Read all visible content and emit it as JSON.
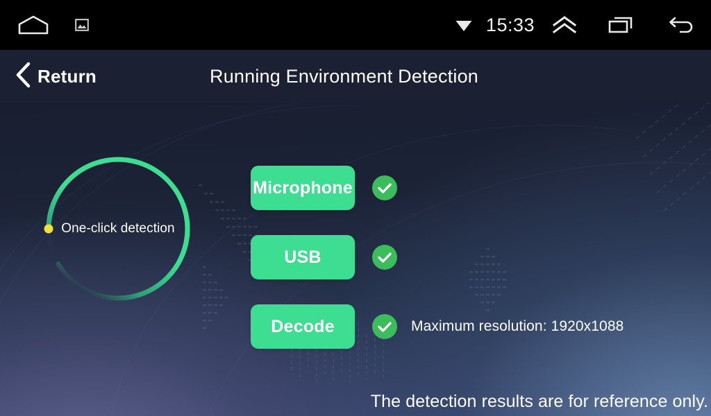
{
  "statusbar": {
    "time": "15:33",
    "left_icons": [
      {
        "name": "home-icon",
        "glyph": "home"
      },
      {
        "name": "screenshot-icon",
        "glyph": "picture"
      }
    ],
    "right_icons": [
      {
        "name": "wifi-icon",
        "glyph": "wifi"
      },
      {
        "name": "expand-up-icon",
        "glyph": "double-chevron-up"
      },
      {
        "name": "recent-apps-icon",
        "glyph": "overlapping-rectangles"
      },
      {
        "name": "back-icon",
        "glyph": "back-arrow"
      }
    ]
  },
  "header": {
    "return_label": "Return",
    "title": "Running Environment Detection",
    "background": "#1b2033"
  },
  "detection": {
    "ring_label": "One-click detection",
    "ring_color": "#3ddd92",
    "ring_marker_color": "#f2e33a",
    "ring_track_color": "#2b3048",
    "progress_percent": 88
  },
  "colors": {
    "button_green": "#3ddd92",
    "check_green": "#3cbd5c",
    "text_white": "#ffffff"
  },
  "tests": [
    {
      "label": "Microphone",
      "status": "pass",
      "status_icon": "check-circle-icon",
      "note": ""
    },
    {
      "label": "USB",
      "status": "pass",
      "status_icon": "check-circle-icon",
      "note": ""
    },
    {
      "label": "Decode",
      "status": "pass",
      "status_icon": "check-circle-icon",
      "note": "Maximum resolution: 1920x1088"
    }
  ],
  "footer": {
    "note": "The detection results are for reference only."
  }
}
